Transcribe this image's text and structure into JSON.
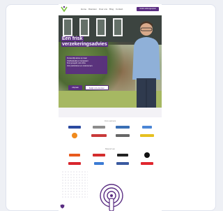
{
  "header": {
    "nav_items": [
      "Home",
      "Diensten",
      "Over ons",
      "Blog",
      "Contact"
    ],
    "cta_label": "Gratis adviesgesprek"
  },
  "hero": {
    "headline_line1": "Een frisk",
    "headline_line2": "verzekeringsadvies",
    "panel_lines": [
      "Persoonlijk advies op maat",
      "Onafhankelijk en transparant",
      "Snel geregeld, ook online",
      "Voor particulieren en ondernemers"
    ],
    "primary_button": "Afspraak",
    "secondary_button": "Bekijk onze diensten"
  },
  "partners": {
    "title": "Onze partners",
    "title2": "Bekend van"
  },
  "colors": {
    "brand_purple": "#5a2d82",
    "page_background": "#eef0f5"
  },
  "icons": {
    "logo": "brand-logo-icon",
    "feature": "wireless-tower-icon"
  }
}
